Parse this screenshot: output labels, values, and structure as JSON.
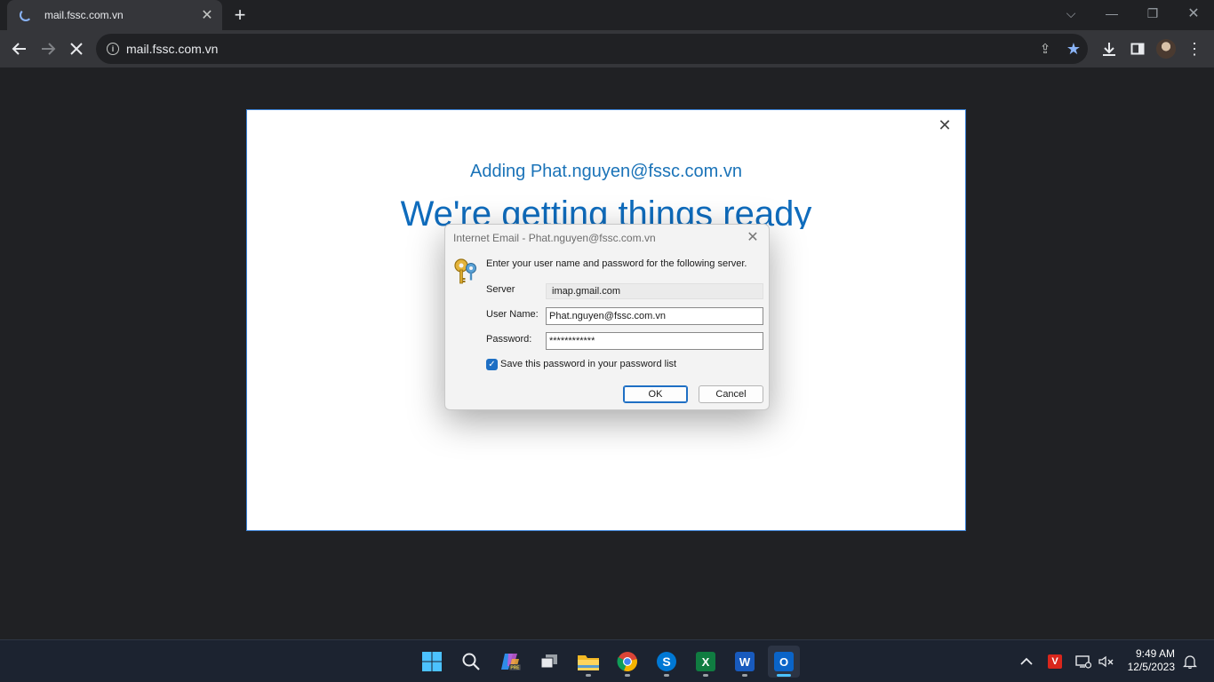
{
  "browser": {
    "tab_title": "mail.fssc.com.vn",
    "url": "mail.fssc.com.vn"
  },
  "setup": {
    "adding_text": "Adding Phat.nguyen@fssc.com.vn",
    "heading": "We're getting things ready"
  },
  "dialog": {
    "title": "Internet Email - Phat.nguyen@fssc.com.vn",
    "prompt": "Enter your user name and password for the following server.",
    "server_label": "Server",
    "server_value": "imap.gmail.com",
    "username_label": "User Name:",
    "username_value": "Phat.nguyen@fssc.com.vn",
    "password_label": "Password:",
    "password_value": "************",
    "save_password_label": "Save this password in your password list",
    "save_password_checked": true,
    "ok_label": "OK",
    "cancel_label": "Cancel"
  },
  "taskbar": {
    "apps": [
      {
        "name": "start",
        "icon": "windows-icon"
      },
      {
        "name": "search",
        "icon": "search-icon"
      },
      {
        "name": "copilot",
        "icon": "copilot-icon"
      },
      {
        "name": "task-view",
        "icon": "task-view-icon"
      },
      {
        "name": "file-explorer",
        "icon": "folder-icon"
      },
      {
        "name": "chrome",
        "icon": "chrome-icon"
      },
      {
        "name": "skype",
        "icon": "skype-icon"
      },
      {
        "name": "excel",
        "icon": "excel-icon"
      },
      {
        "name": "word",
        "icon": "word-icon"
      },
      {
        "name": "outlook",
        "icon": "outlook-icon"
      }
    ],
    "time": "9:49 AM",
    "date": "12/5/2023"
  },
  "colors": {
    "accent_blue": "#0f6cbd",
    "browser_dark": "#202124",
    "taskbar": "#1c2330"
  }
}
